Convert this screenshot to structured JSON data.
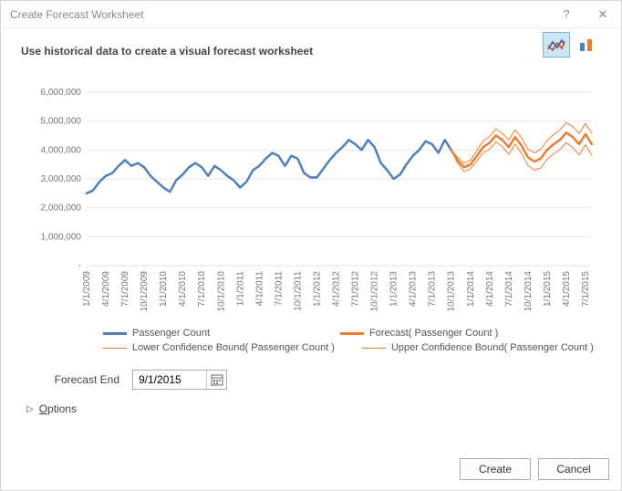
{
  "window": {
    "title": "Create Forecast Worksheet",
    "help_glyph": "?",
    "close_glyph": "✕"
  },
  "heading": "Use historical data to create a visual forecast worksheet",
  "chart_types": {
    "line_name": "line-chart-type",
    "bar_name": "bar-chart-type",
    "selected": "line"
  },
  "legend": {
    "history": "Passenger Count",
    "forecast": "Forecast( Passenger Count )",
    "lower": "Lower Confidence Bound( Passenger Count )",
    "upper": "Upper Confidence Bound( Passenger Count )"
  },
  "forecast_end": {
    "label": "Forecast End",
    "value": "9/1/2015"
  },
  "options_label_prefix": "O",
  "options_label_rest": "ptions",
  "buttons": {
    "create": "Create",
    "cancel": "Cancel"
  },
  "colors": {
    "history": "#4f81bd",
    "forecast": "#ed7d31"
  },
  "chart_data": {
    "type": "line",
    "xlabel": "",
    "ylabel": "",
    "ylim": [
      0,
      6000000
    ],
    "y_ticks": [
      0,
      1000000,
      2000000,
      3000000,
      4000000,
      5000000,
      6000000
    ],
    "y_tick_labels": [
      "-",
      "1,000,000",
      "2,000,000",
      "3,000,000",
      "4,000,000",
      "5,000,000",
      "6,000,000"
    ],
    "x_categories": [
      "1/1/2009",
      "4/1/2009",
      "7/1/2009",
      "10/1/2009",
      "1/1/2010",
      "4/1/2010",
      "7/1/2010",
      "10/1/2010",
      "1/1/2011",
      "4/1/2011",
      "7/1/2011",
      "10/1/2011",
      "1/1/2012",
      "4/1/2012",
      "7/1/2012",
      "10/1/2012",
      "1/1/2013",
      "4/1/2013",
      "7/1/2013",
      "10/1/2013",
      "1/1/2014",
      "4/1/2014",
      "7/1/2014",
      "10/1/2014",
      "1/1/2015",
      "4/1/2015",
      "7/1/2015"
    ],
    "x_tick_step": 3,
    "series": [
      {
        "name": "Passenger Count",
        "role": "history",
        "color": "#4f81bd",
        "weight": 2.5,
        "x_start": 0,
        "values": [
          2500000,
          2600000,
          2900000,
          3100000,
          3200000,
          3450000,
          3650000,
          3450000,
          3550000,
          3400000,
          3100000,
          2900000,
          2700000,
          2550000,
          2950000,
          3150000,
          3400000,
          3550000,
          3400000,
          3100000,
          3450000,
          3300000,
          3100000,
          2950000,
          2700000,
          2900000,
          3300000,
          3450000,
          3700000,
          3900000,
          3800000,
          3450000,
          3800000,
          3700000,
          3200000,
          3050000,
          3050000,
          3350000,
          3650000,
          3900000,
          4100000,
          4350000,
          4200000,
          4000000,
          4350000,
          4100000,
          3550000,
          3300000,
          3000000,
          3150000,
          3500000,
          3800000,
          4000000,
          4300000,
          4200000,
          3900000,
          4350000,
          4000000
        ]
      },
      {
        "name": "Forecast( Passenger Count )",
        "role": "forecast",
        "color": "#ed7d31",
        "weight": 2.5,
        "x_start": 57,
        "values": [
          4000000,
          3650000,
          3400000,
          3500000,
          3800000,
          4100000,
          4250000,
          4500000,
          4350000,
          4100000,
          4450000,
          4150000,
          3750000,
          3600000,
          3700000,
          4000000,
          4200000,
          4350000,
          4600000,
          4450000,
          4200000,
          4550000,
          4200000
        ]
      },
      {
        "name": "Lower Confidence Bound( Passenger Count )",
        "role": "lower",
        "color": "#ed7d31",
        "weight": 1,
        "x_start": 57,
        "values": [
          4000000,
          3550000,
          3250000,
          3350000,
          3620000,
          3900000,
          4030000,
          4280000,
          4120000,
          3850000,
          4200000,
          3880000,
          3470000,
          3300000,
          3380000,
          3680000,
          3870000,
          4010000,
          4250000,
          4090000,
          3830000,
          4180000,
          3820000
        ]
      },
      {
        "name": "Upper Confidence Bound( Passenger Count )",
        "role": "upper",
        "color": "#ed7d31",
        "weight": 1,
        "x_start": 57,
        "values": [
          4000000,
          3750000,
          3550000,
          3650000,
          3980000,
          4300000,
          4470000,
          4720000,
          4580000,
          4350000,
          4700000,
          4420000,
          4030000,
          3900000,
          4020000,
          4320000,
          4530000,
          4690000,
          4950000,
          4810000,
          4570000,
          4920000,
          4580000
        ]
      }
    ]
  }
}
